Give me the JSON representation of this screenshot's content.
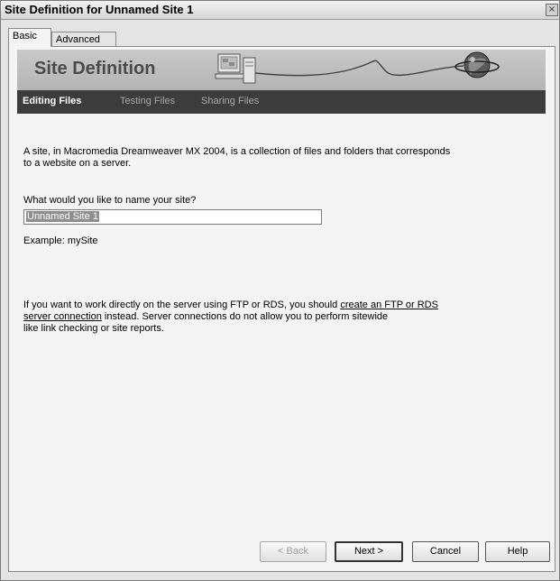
{
  "window": {
    "title": "Site Definition for Unnamed Site 1",
    "close_glyph": "×"
  },
  "tabs": [
    {
      "label": "Basic"
    },
    {
      "label": "Advanced"
    }
  ],
  "banner": {
    "title": "Site Definition"
  },
  "wizard_steps": [
    {
      "label": "Editing Files"
    },
    {
      "label": "Testing Files"
    },
    {
      "label": "Sharing Files"
    }
  ],
  "content": {
    "intro_line1": "A site, in Macromedia Dreamweaver MX 2004, is a collection of files and folders that corresponds",
    "intro_line2": "to a website on a server.",
    "name_question": "What would you like to name your site?",
    "site_name_value": "Unnamed Site 1",
    "example": "Example: mySite",
    "ftp_line1_prefix": "If you want to work directly on the server using FTP or RDS, you should ",
    "ftp_link_part1": "create an FTP or RDS",
    "ftp_link_part2": "server connection",
    "ftp_line2_suffix": " instead. Server connections do not allow you to perform sitewide",
    "ftp_line3": "like link checking or site reports."
  },
  "buttons": {
    "back": "< Back",
    "next": "Next >",
    "cancel": "Cancel",
    "help": "Help"
  }
}
